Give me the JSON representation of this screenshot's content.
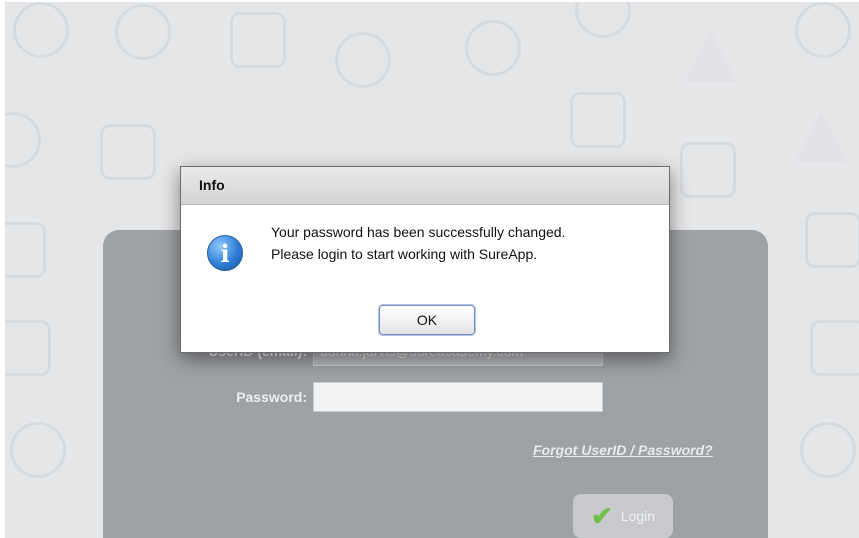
{
  "background": {
    "login": {
      "userid_label": "UserID (email):",
      "userid_value": "donna.jarvis@sureacademy.com",
      "password_label": "Password:",
      "password_value": "",
      "forgot_link": "Forgot UserID / Password?",
      "login_button": "Login"
    }
  },
  "dialog": {
    "title": "Info",
    "message_line1": "Your password has been successfully changed.",
    "message_line2": "Please login to start working with SureApp.",
    "ok_button": "OK",
    "icon": "info-icon"
  },
  "colors": {
    "page_bg": "#e5e6e8",
    "panel_bg": "#9fa2a5",
    "check": "#6fbf4a",
    "info_blue": "#2f7fd6"
  }
}
